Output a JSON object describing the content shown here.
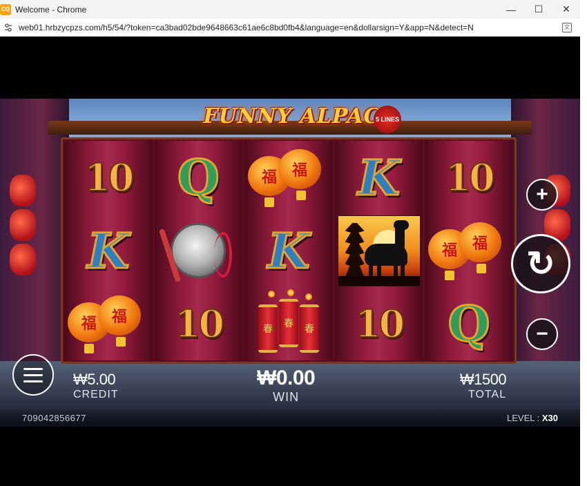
{
  "browser": {
    "window_title": "Welcome - Chrome",
    "app_icon_text": "CQ",
    "url": "web01.hrbzycpzs.com/h5/54/?token=ca3bad02bde9648663c61ae6c8bd0fb4&language=en&dollarsign=Y&app=N&detect=N",
    "controls": {
      "minimize": "—",
      "maximize": "☐",
      "close": "✕"
    }
  },
  "game": {
    "title": "FUNNY ALPACA",
    "lines_badge": "5 LINES",
    "reels": [
      [
        "10",
        "K",
        "lantern"
      ],
      [
        "Q",
        "gong",
        "10"
      ],
      [
        "lantern",
        "K",
        "firecrackers"
      ],
      [
        "K",
        "alpaca",
        "10"
      ],
      [
        "10",
        "lantern",
        "Q"
      ]
    ],
    "lantern_char": "福",
    "firecracker_char": "春",
    "buttons": {
      "plus": "+",
      "minus": "−",
      "spin": "↻"
    },
    "credit": {
      "value": "₩5.00",
      "label": "CREDIT"
    },
    "win": {
      "value": "₩0.00",
      "label": "WIN"
    },
    "total": {
      "value": "₩1500",
      "label": "TOTAL"
    },
    "game_id": "709042856677",
    "level": {
      "label": "LEVEL :",
      "value": "X30"
    }
  }
}
